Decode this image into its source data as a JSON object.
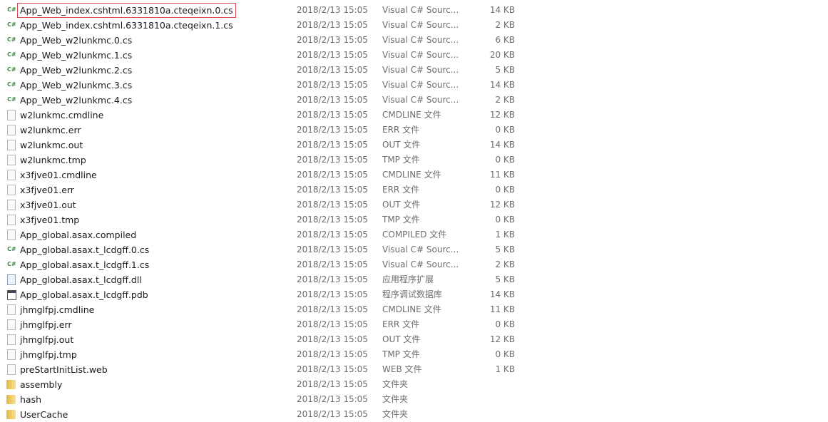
{
  "files": [
    {
      "name": "App_Web_index.cshtml.6331810a.cteqeixn.0.cs",
      "date": "2018/2/13 15:05",
      "type": "Visual C# Sourc...",
      "size": "14 KB",
      "icon": "csharp-file-icon",
      "selected": true
    },
    {
      "name": "App_Web_index.cshtml.6331810a.cteqeixn.1.cs",
      "date": "2018/2/13 15:05",
      "type": "Visual C# Sourc...",
      "size": "2 KB",
      "icon": "csharp-file-icon"
    },
    {
      "name": "App_Web_w2lunkmc.0.cs",
      "date": "2018/2/13 15:05",
      "type": "Visual C# Sourc...",
      "size": "6 KB",
      "icon": "csharp-file-icon"
    },
    {
      "name": "App_Web_w2lunkmc.1.cs",
      "date": "2018/2/13 15:05",
      "type": "Visual C# Sourc...",
      "size": "20 KB",
      "icon": "csharp-file-icon"
    },
    {
      "name": "App_Web_w2lunkmc.2.cs",
      "date": "2018/2/13 15:05",
      "type": "Visual C# Sourc...",
      "size": "5 KB",
      "icon": "csharp-file-icon"
    },
    {
      "name": "App_Web_w2lunkmc.3.cs",
      "date": "2018/2/13 15:05",
      "type": "Visual C# Sourc...",
      "size": "14 KB",
      "icon": "csharp-file-icon"
    },
    {
      "name": "App_Web_w2lunkmc.4.cs",
      "date": "2018/2/13 15:05",
      "type": "Visual C# Sourc...",
      "size": "2 KB",
      "icon": "csharp-file-icon"
    },
    {
      "name": "w2lunkmc.cmdline",
      "date": "2018/2/13 15:05",
      "type": "CMDLINE 文件",
      "size": "12 KB",
      "icon": "file-icon"
    },
    {
      "name": "w2lunkmc.err",
      "date": "2018/2/13 15:05",
      "type": "ERR 文件",
      "size": "0 KB",
      "icon": "file-icon"
    },
    {
      "name": "w2lunkmc.out",
      "date": "2018/2/13 15:05",
      "type": "OUT 文件",
      "size": "14 KB",
      "icon": "file-icon"
    },
    {
      "name": "w2lunkmc.tmp",
      "date": "2018/2/13 15:05",
      "type": "TMP 文件",
      "size": "0 KB",
      "icon": "file-icon"
    },
    {
      "name": "x3fjve01.cmdline",
      "date": "2018/2/13 15:05",
      "type": "CMDLINE 文件",
      "size": "11 KB",
      "icon": "file-icon"
    },
    {
      "name": "x3fjve01.err",
      "date": "2018/2/13 15:05",
      "type": "ERR 文件",
      "size": "0 KB",
      "icon": "file-icon"
    },
    {
      "name": "x3fjve01.out",
      "date": "2018/2/13 15:05",
      "type": "OUT 文件",
      "size": "12 KB",
      "icon": "file-icon"
    },
    {
      "name": "x3fjve01.tmp",
      "date": "2018/2/13 15:05",
      "type": "TMP 文件",
      "size": "0 KB",
      "icon": "file-icon"
    },
    {
      "name": "App_global.asax.compiled",
      "date": "2018/2/13 15:05",
      "type": "COMPILED 文件",
      "size": "1 KB",
      "icon": "file-icon"
    },
    {
      "name": "App_global.asax.t_lcdgff.0.cs",
      "date": "2018/2/13 15:05",
      "type": "Visual C# Sourc...",
      "size": "5 KB",
      "icon": "csharp-file-icon"
    },
    {
      "name": "App_global.asax.t_lcdgff.1.cs",
      "date": "2018/2/13 15:05",
      "type": "Visual C# Sourc...",
      "size": "2 KB",
      "icon": "csharp-file-icon"
    },
    {
      "name": "App_global.asax.t_lcdgff.dll",
      "date": "2018/2/13 15:05",
      "type": "应用程序扩展",
      "size": "5 KB",
      "icon": "dll-file-icon"
    },
    {
      "name": "App_global.asax.t_lcdgff.pdb",
      "date": "2018/2/13 15:05",
      "type": "程序调试数据库",
      "size": "14 KB",
      "icon": "pdb-file-icon"
    },
    {
      "name": "jhmglfpj.cmdline",
      "date": "2018/2/13 15:05",
      "type": "CMDLINE 文件",
      "size": "11 KB",
      "icon": "file-icon"
    },
    {
      "name": "jhmglfpj.err",
      "date": "2018/2/13 15:05",
      "type": "ERR 文件",
      "size": "0 KB",
      "icon": "file-icon"
    },
    {
      "name": "jhmglfpj.out",
      "date": "2018/2/13 15:05",
      "type": "OUT 文件",
      "size": "12 KB",
      "icon": "file-icon"
    },
    {
      "name": "jhmglfpj.tmp",
      "date": "2018/2/13 15:05",
      "type": "TMP 文件",
      "size": "0 KB",
      "icon": "file-icon"
    },
    {
      "name": "preStartInitList.web",
      "date": "2018/2/13 15:05",
      "type": "WEB 文件",
      "size": "1 KB",
      "icon": "file-icon"
    },
    {
      "name": "assembly",
      "date": "2018/2/13 15:05",
      "type": "文件夹",
      "size": "",
      "icon": "folder-icon"
    },
    {
      "name": "hash",
      "date": "2018/2/13 15:05",
      "type": "文件夹",
      "size": "",
      "icon": "folder-icon"
    },
    {
      "name": "UserCache",
      "date": "2018/2/13 15:05",
      "type": "文件夹",
      "size": "",
      "icon": "folder-icon"
    }
  ],
  "csharp_icon_text": "C#",
  "highlight_color": "#d9464c"
}
